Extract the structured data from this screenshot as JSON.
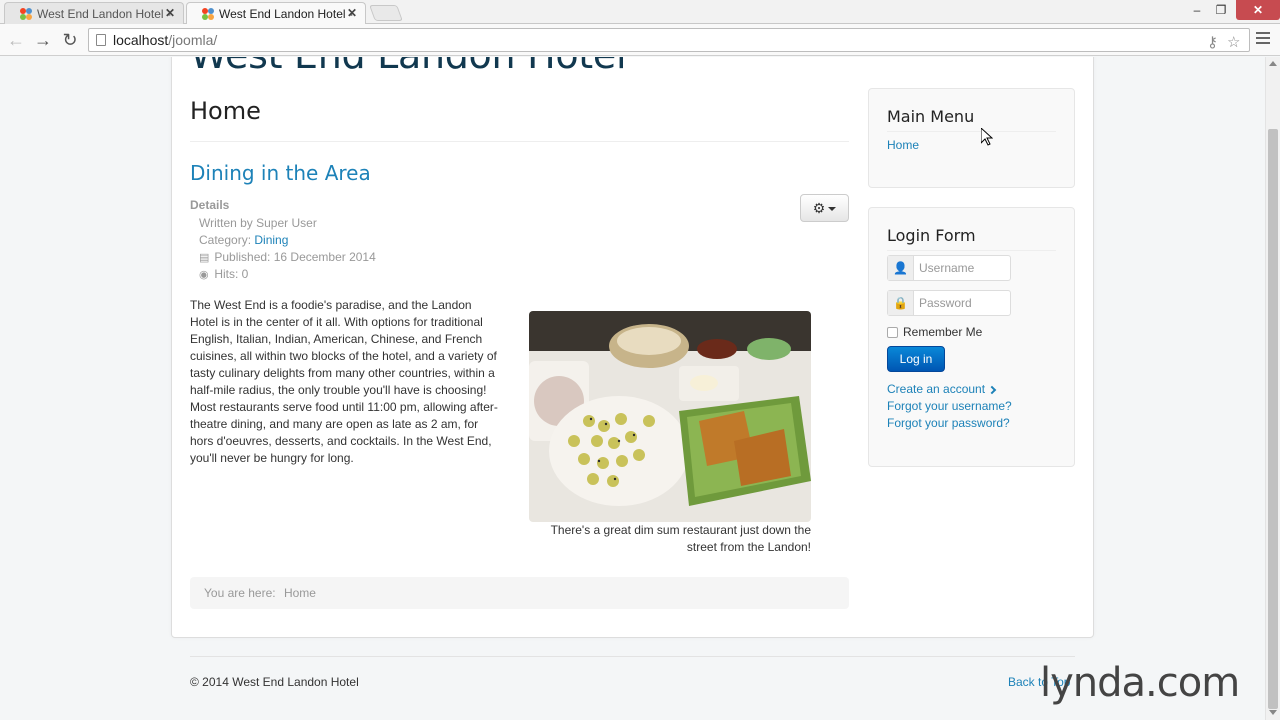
{
  "browser": {
    "tabs": [
      {
        "title": "West End Landon Hotel - ",
        "active": false
      },
      {
        "title": "West End Landon Hotel - ",
        "active": true
      }
    ],
    "url_host": "localhost",
    "url_path": "/joomla/",
    "window_controls": {
      "minimize": "–",
      "restore": "❐",
      "close": "✕"
    }
  },
  "site": {
    "title": "West End Landon Hotel",
    "page_heading": "Home"
  },
  "article": {
    "title": "Dining in the Area",
    "details_label": "Details",
    "written_by": "Written by Super User",
    "category_label": "Category:",
    "category_value": "Dining",
    "published": "Published: 16 December 2014",
    "hits": "Hits: 0",
    "body": "The West End is a foodie's paradise, and the Landon Hotel is in the center of it all. With options for traditional English, Italian, Indian, American, Chinese, and French cuisines, all within two blocks of the hotel, and a variety of tasty culinary delights from many other countries, within a half-mile radius, the only trouble you'll have is choosing! Most restaurants serve food until 11:00 pm, allowing after-theatre dining, and many are open as late as 2 am, for hors d'oeuvres, desserts, and cocktails. In the West End, you'll never be hungry for long.",
    "image_caption": "There's a great dim sum restaurant just down the street from the Landon!"
  },
  "breadcrumb": {
    "label": "You are here:",
    "current": "Home"
  },
  "main_menu": {
    "title": "Main Menu",
    "items": [
      "Home"
    ]
  },
  "login_form": {
    "title": "Login Form",
    "username_placeholder": "Username",
    "password_placeholder": "Password",
    "remember_label": "Remember Me",
    "login_button": "Log in",
    "create_account": "Create an account",
    "forgot_username": "Forgot your username?",
    "forgot_password": "Forgot your password?"
  },
  "footer": {
    "copyright": "© 2014 West End Landon Hotel",
    "back_to_top": "Back to Top"
  },
  "watermark": {
    "brand": "lynda",
    "suffix": ".com"
  },
  "colors": {
    "link": "#1d82b8",
    "site_title": "#11384f",
    "login_button": "#0a6ec4",
    "page_bg": "#f4f6f7"
  }
}
